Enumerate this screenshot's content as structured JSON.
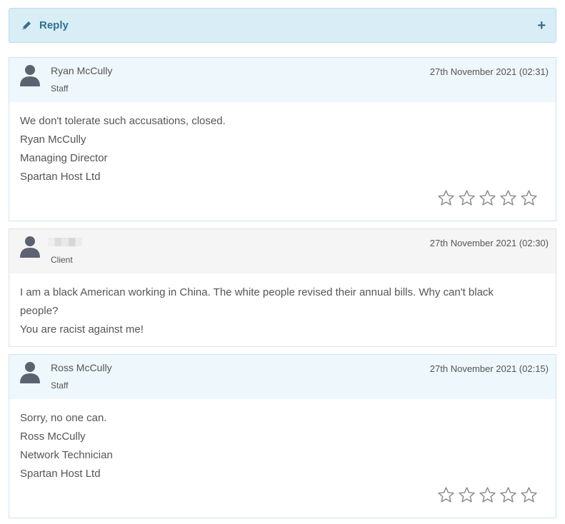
{
  "reply_bar": {
    "label": "Reply",
    "expand_symbol": "+"
  },
  "replies": [
    {
      "name": "Ryan McCully",
      "role": "Staff",
      "date": "27th November 2021 (02:31)",
      "lines": [
        "We don't tolerate such accusations, closed.",
        "Ryan McCully",
        "Managing Director",
        "Spartan Host Ltd"
      ],
      "rating_stars": 5
    },
    {
      "name": "",
      "role": "Client",
      "date": "27th November 2021 (02:30)",
      "lines": [
        "I am a black American working in China. The white people revised their annual bills. Why can't black",
        "people?",
        "You are racist against me!"
      ]
    },
    {
      "name": "Ross McCully",
      "role": "Staff",
      "date": "27th November 2021 (02:15)",
      "lines": [
        "Sorry, no one can.",
        "Ross McCully",
        "Network Technician",
        "Spartan Host Ltd"
      ],
      "rating_stars": 5
    }
  ],
  "colors": {
    "accent": "#31708f",
    "reply_bg": "#d9edf7",
    "staff_header_bg": "#eef7fc",
    "client_header_bg": "#f5f5f5",
    "avatar": "#5b6270",
    "star_outline": "#8a8a8a"
  },
  "icons": {
    "reply": "pencil-icon",
    "expand": "plus-icon",
    "avatar": "user-icon",
    "rating": "star-outline-icon"
  }
}
